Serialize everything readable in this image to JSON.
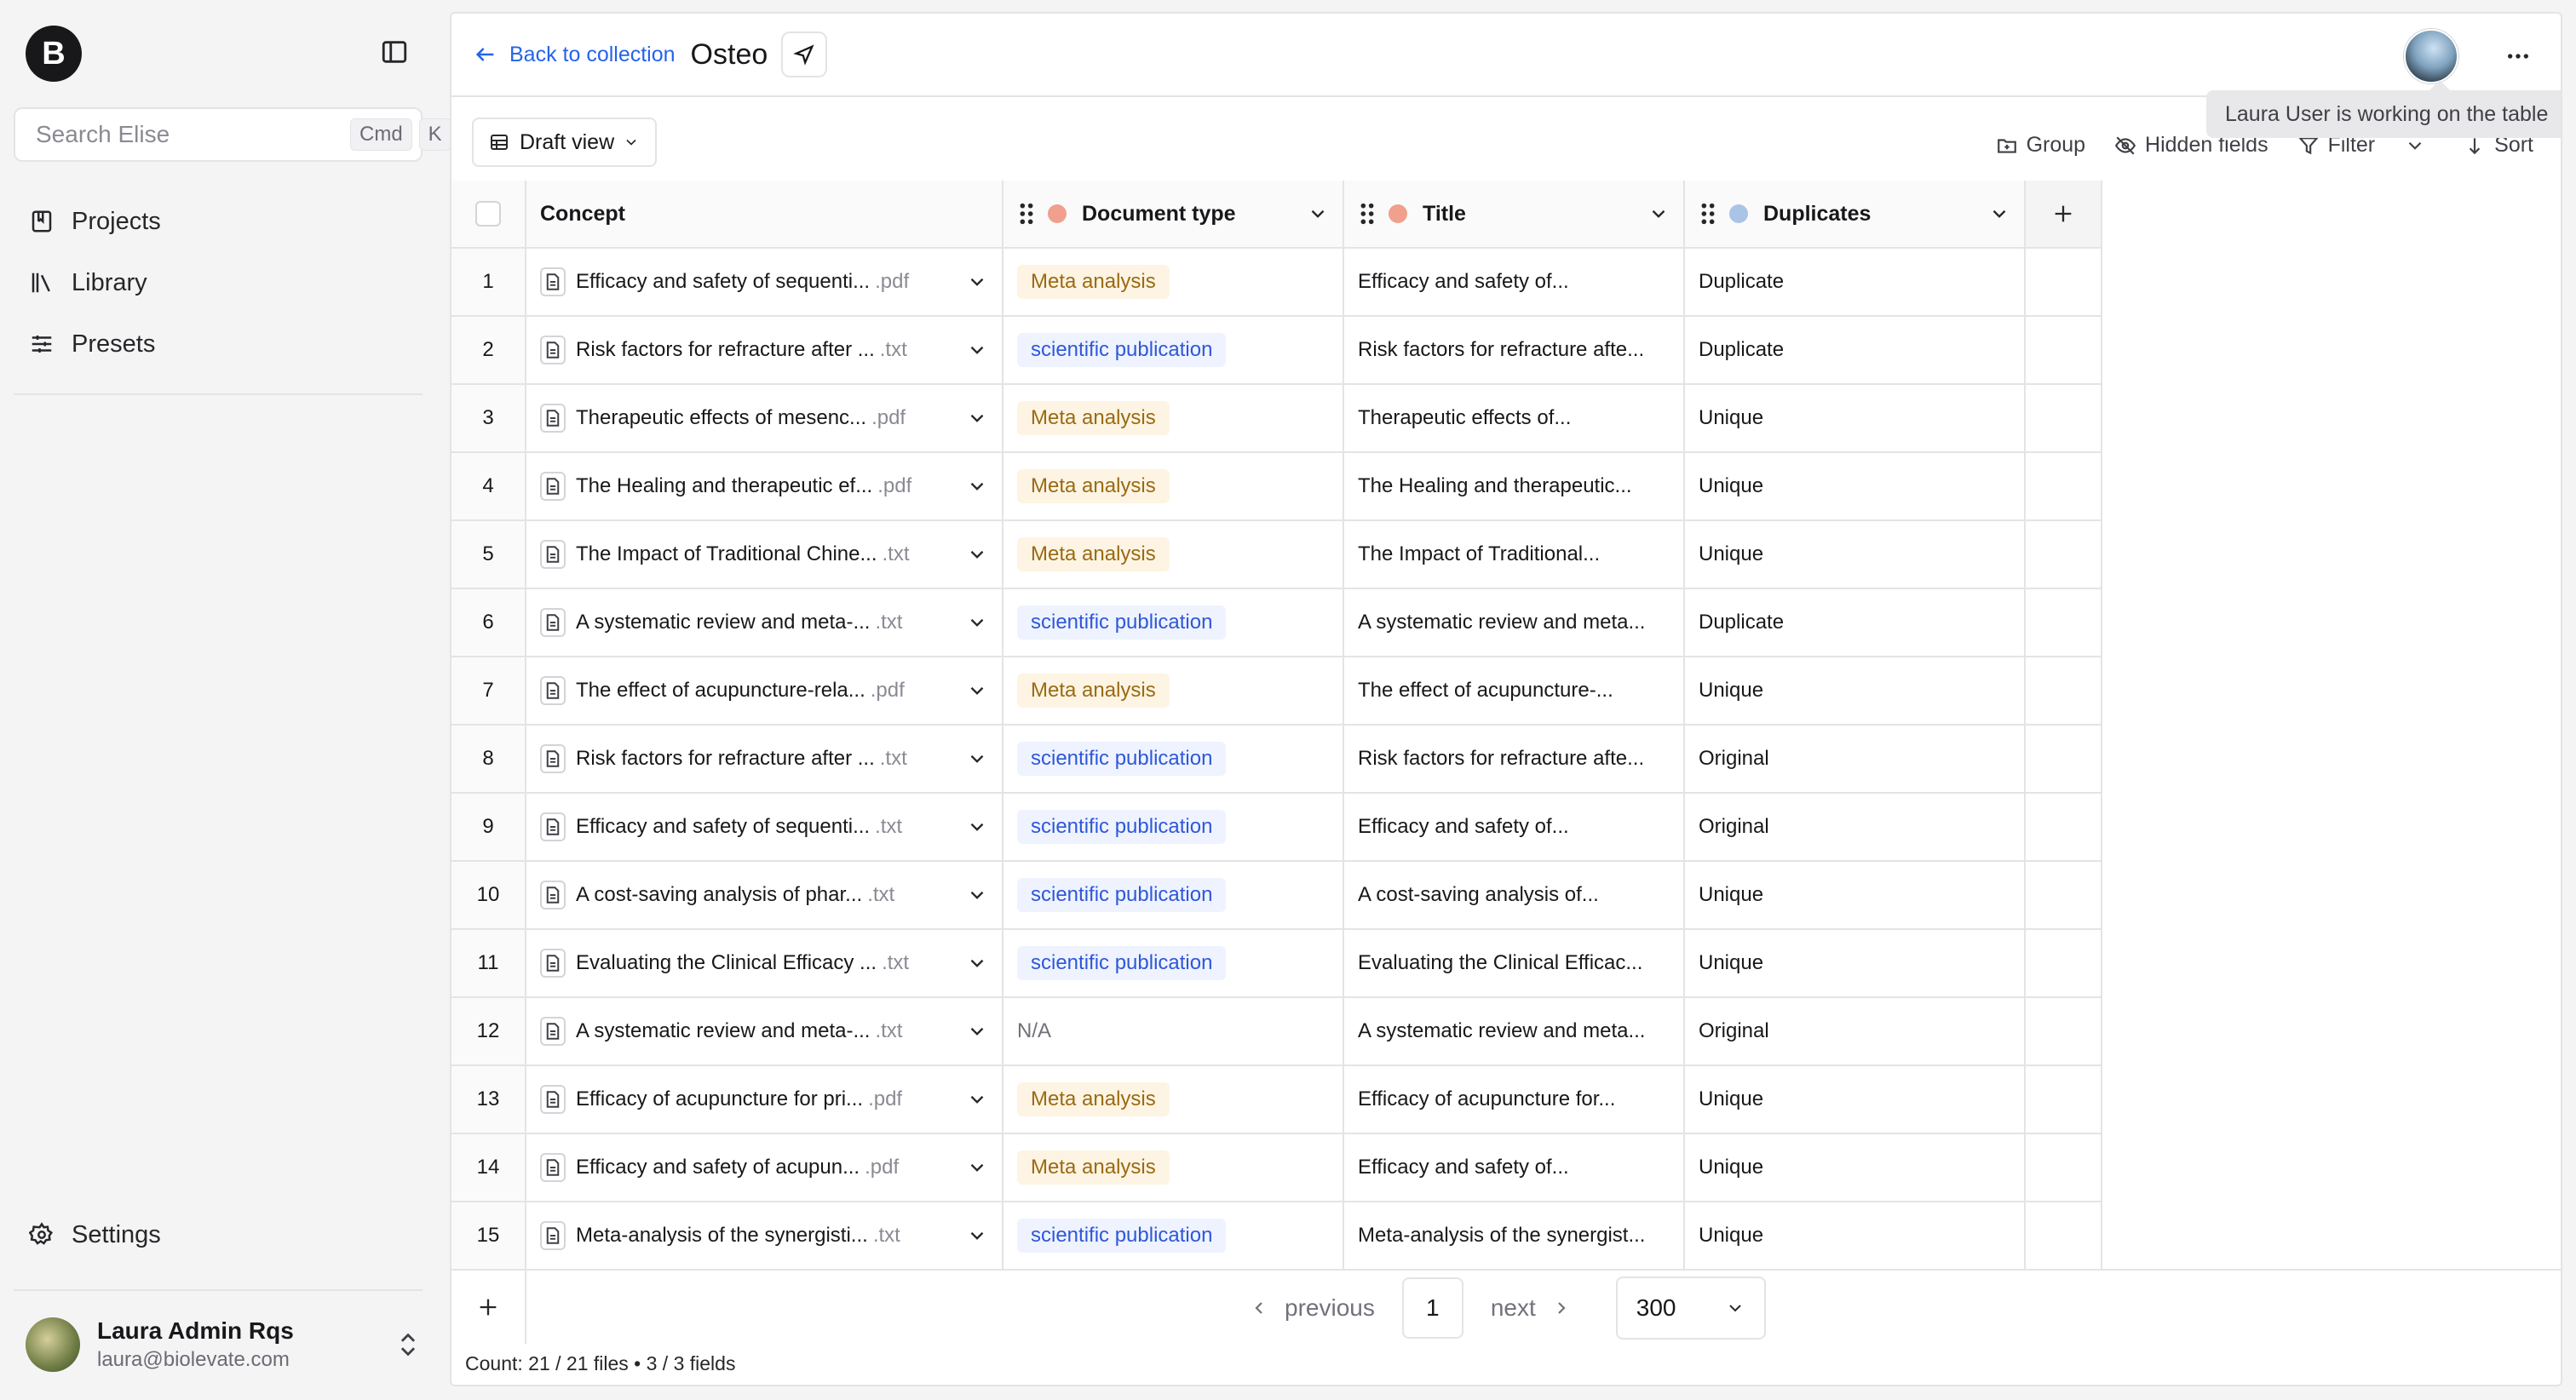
{
  "sidebar": {
    "logo_letter": "B",
    "search": {
      "placeholder": "Search Elise",
      "shortcut_cmd": "Cmd",
      "shortcut_key": "K"
    },
    "nav": [
      {
        "label": "Projects",
        "icon": "book-icon"
      },
      {
        "label": "Library",
        "icon": "library-icon"
      },
      {
        "label": "Presets",
        "icon": "sliders-icon"
      }
    ],
    "settings_label": "Settings",
    "user": {
      "name": "Laura Admin Rqs",
      "email": "laura@biolevate.com"
    }
  },
  "header": {
    "back_label": "Back to collection",
    "title": "Osteo",
    "tooltip": "Laura User is working on the table"
  },
  "toolbar": {
    "view_label": "Draft view",
    "group_label": "Group",
    "hidden_fields_label": "Hidden fields",
    "filter_label": "Filter",
    "sort_label": "Sort"
  },
  "table": {
    "columns": {
      "concept": "Concept",
      "doc_type": "Document type",
      "title": "Title",
      "duplicates": "Duplicates"
    },
    "colors": {
      "doc_type_dot": "#f0a08c",
      "title_dot": "#f0a08c",
      "duplicates_dot": "#a9c4e6"
    },
    "rows": [
      {
        "num": "1",
        "file": "Efficacy and safety of sequenti...",
        "ext": ".pdf",
        "doc_type": "Meta analysis",
        "kind": "meta",
        "title": "Efficacy and safety of...",
        "dup": "Duplicate"
      },
      {
        "num": "2",
        "file": "Risk factors for refracture after ...",
        "ext": ".txt",
        "doc_type": "scientific publication",
        "kind": "sci",
        "title": "Risk factors for refracture afte...",
        "dup": "Duplicate"
      },
      {
        "num": "3",
        "file": "Therapeutic effects of mesenc...",
        "ext": ".pdf",
        "doc_type": "Meta analysis",
        "kind": "meta",
        "title": "Therapeutic effects of...",
        "dup": "Unique"
      },
      {
        "num": "4",
        "file": "The Healing and therapeutic ef...",
        "ext": ".pdf",
        "doc_type": "Meta analysis",
        "kind": "meta",
        "title": "The Healing and therapeutic...",
        "dup": "Unique"
      },
      {
        "num": "5",
        "file": "The Impact of Traditional Chine...",
        "ext": ".txt",
        "doc_type": "Meta analysis",
        "kind": "meta",
        "title": "The Impact of Traditional...",
        "dup": "Unique"
      },
      {
        "num": "6",
        "file": "A systematic review and meta-...",
        "ext": ".txt",
        "doc_type": "scientific publication",
        "kind": "sci",
        "title": "A systematic review and meta...",
        "dup": "Duplicate"
      },
      {
        "num": "7",
        "file": "The effect of acupuncture-rela...",
        "ext": ".pdf",
        "doc_type": "Meta analysis",
        "kind": "meta",
        "title": "The effect of acupuncture-...",
        "dup": "Unique"
      },
      {
        "num": "8",
        "file": "Risk factors for refracture after ...",
        "ext": ".txt",
        "doc_type": "scientific publication",
        "kind": "sci",
        "title": "Risk factors for refracture afte...",
        "dup": "Original"
      },
      {
        "num": "9",
        "file": "Efficacy and safety of sequenti...",
        "ext": ".txt",
        "doc_type": "scientific publication",
        "kind": "sci",
        "title": "Efficacy and safety of...",
        "dup": "Original"
      },
      {
        "num": "10",
        "file": "A cost-saving analysis of phar...",
        "ext": ".txt",
        "doc_type": "scientific publication",
        "kind": "sci",
        "title": "A cost-saving analysis of...",
        "dup": "Unique"
      },
      {
        "num": "11",
        "file": "Evaluating the Clinical Efficacy ...",
        "ext": ".txt",
        "doc_type": "scientific publication",
        "kind": "sci",
        "title": "Evaluating the Clinical Efficac...",
        "dup": "Unique"
      },
      {
        "num": "12",
        "file": "A systematic review and meta-...",
        "ext": ".txt",
        "doc_type": "N/A",
        "kind": "na",
        "title": "A systematic review and meta...",
        "dup": "Original"
      },
      {
        "num": "13",
        "file": "Efficacy of acupuncture for pri...",
        "ext": ".pdf",
        "doc_type": "Meta analysis",
        "kind": "meta",
        "title": "Efficacy of acupuncture for...",
        "dup": "Unique"
      },
      {
        "num": "14",
        "file": "Efficacy and safety of acupun...",
        "ext": ".pdf",
        "doc_type": "Meta analysis",
        "kind": "meta",
        "title": "Efficacy and safety of...",
        "dup": "Unique"
      },
      {
        "num": "15",
        "file": "Meta-analysis of the synergisti...",
        "ext": ".txt",
        "doc_type": "scientific publication",
        "kind": "sci",
        "title": "Meta-analysis of the synergist...",
        "dup": "Unique"
      }
    ]
  },
  "pagination": {
    "previous_label": "previous",
    "next_label": "next",
    "page": "1",
    "per_page": "300"
  },
  "count_text": "Count: 21 / 21 files • 3 / 3 fields",
  "colors": {
    "accent": "#2563eb",
    "meta_tag_bg": "#fdf4e3",
    "meta_tag_fg": "#9a6a12",
    "sci_tag_bg": "#eef3ff",
    "sci_tag_fg": "#2f57d9"
  }
}
